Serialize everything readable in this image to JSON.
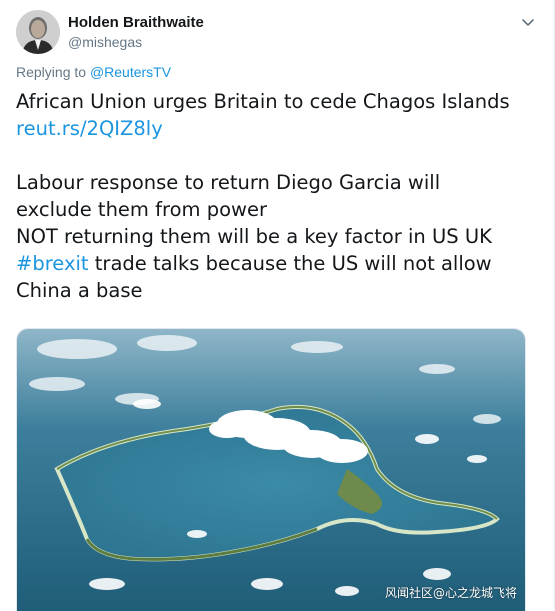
{
  "author": {
    "display_name": "Holden Braithwaite",
    "handle": "@mishegas",
    "avatar_icon": "person-portrait-icon"
  },
  "reply": {
    "prefix": "Replying to ",
    "target": "@ReutersTV"
  },
  "text": {
    "line1": "African Union urges Britain to cede Chagos Islands",
    "link": "reut.rs/2QIZ8ly",
    "line3": "Labour response to return Diego Garcia will",
    "line4": "exclude them from power",
    "line5": "NOT returning them will be a key factor in US UK",
    "hashtag": "#brexit",
    "line6_rest": " trade talks because the US will not allow",
    "line7": "China a base"
  },
  "media": {
    "description_icon": "aerial-atoll-photo",
    "watermark": "风闻社区@心之龙城飞将"
  },
  "colors": {
    "link": "#1b95e0",
    "secondary": "#657786",
    "ocean": "#2f6f8c"
  }
}
